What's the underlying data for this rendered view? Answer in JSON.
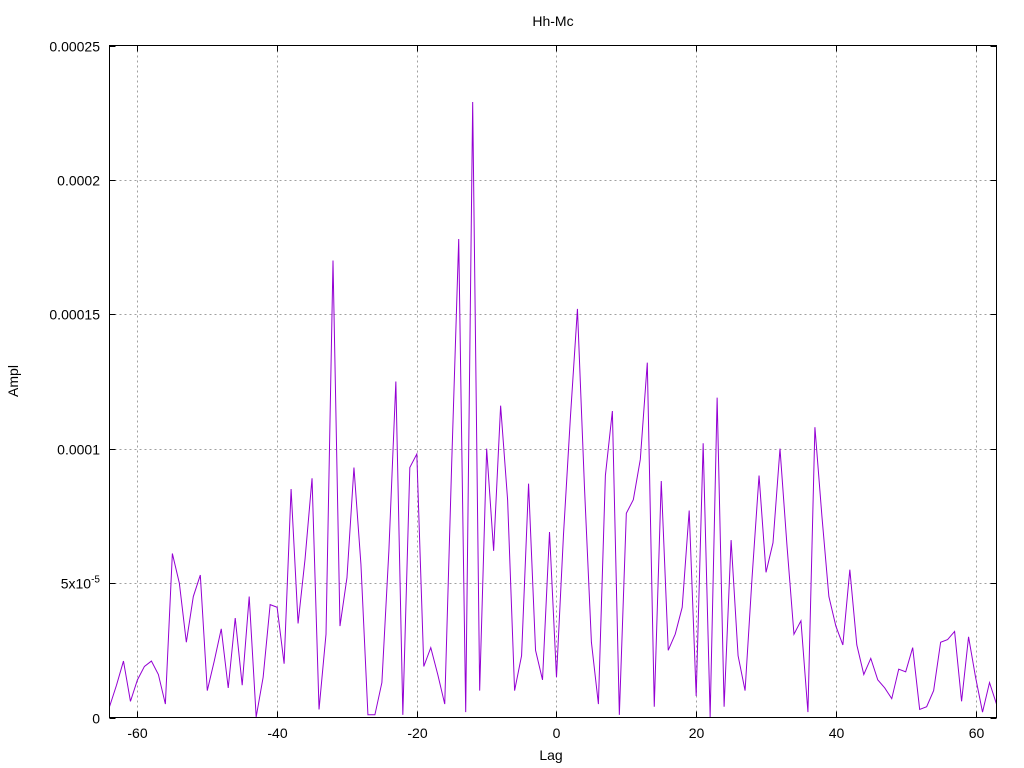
{
  "chart_data": {
    "type": "line",
    "title": "Hh-Mc",
    "xlabel": "Lag",
    "ylabel": "Ampl",
    "xlim": [
      -64,
      63
    ],
    "ylim": [
      0,
      0.00025
    ],
    "grid": true,
    "line_color": "#9400d3",
    "x_ticks": [
      {
        "value": -60,
        "label": "-60"
      },
      {
        "value": -40,
        "label": "-40"
      },
      {
        "value": -20,
        "label": "-20"
      },
      {
        "value": 0,
        "label": "0"
      },
      {
        "value": 20,
        "label": "20"
      },
      {
        "value": 40,
        "label": "40"
      },
      {
        "value": 60,
        "label": "60"
      }
    ],
    "y_ticks": [
      {
        "value": 0,
        "label": "0"
      },
      {
        "value": 5e-05,
        "label": "5x10",
        "sup": "-5"
      },
      {
        "value": 0.0001,
        "label": "0.0001"
      },
      {
        "value": 0.00015,
        "label": "0.00015"
      },
      {
        "value": 0.0002,
        "label": "0.0002"
      },
      {
        "value": 0.00025,
        "label": "0.00025"
      }
    ],
    "series": [
      {
        "x": [
          -64,
          -63,
          -62,
          -61,
          -60,
          -59,
          -58,
          -57,
          -56,
          -55,
          -54,
          -53,
          -52,
          -51,
          -50,
          -49,
          -48,
          -47,
          -46,
          -45,
          -44,
          -43,
          -42,
          -41,
          -40,
          -39,
          -38,
          -37,
          -36,
          -35,
          -34,
          -33,
          -32,
          -31,
          -30,
          -29,
          -28,
          -27,
          -26,
          -25,
          -24,
          -23,
          -22,
          -21,
          -20,
          -19,
          -18,
          -17,
          -16,
          -15,
          -14,
          -13,
          -12,
          -11,
          -10,
          -9,
          -8,
          -7,
          -6,
          -5,
          -4,
          -3,
          -2,
          -1,
          0,
          1,
          2,
          3,
          4,
          5,
          6,
          7,
          8,
          9,
          10,
          11,
          12,
          13,
          14,
          15,
          16,
          17,
          18,
          19,
          20,
          21,
          22,
          23,
          24,
          25,
          26,
          27,
          28,
          29,
          30,
          31,
          32,
          33,
          34,
          35,
          36,
          37,
          38,
          39,
          40,
          41,
          42,
          43,
          44,
          45,
          46,
          47,
          48,
          49,
          50,
          51,
          52,
          53,
          54,
          55,
          56,
          57,
          58,
          59,
          60,
          61,
          62,
          63
        ],
        "y": [
          4e-06,
          1.2e-05,
          2.1e-05,
          6e-06,
          1.4e-05,
          1.9e-05,
          2.1e-05,
          1.6e-05,
          5e-06,
          6.1e-05,
          5e-05,
          2.8e-05,
          4.5e-05,
          5.3e-05,
          1e-05,
          2.1e-05,
          3.3e-05,
          1.1e-05,
          3.7e-05,
          1.2e-05,
          4.5e-05,
          2e-07,
          1.5e-05,
          4.2e-05,
          4.1e-05,
          2e-05,
          8.5e-05,
          3.5e-05,
          5.9e-05,
          8.9e-05,
          3e-06,
          3.1e-05,
          0.00017,
          3.4e-05,
          5.2e-05,
          9.3e-05,
          5.7e-05,
          1e-06,
          1e-06,
          1.3e-05,
          6.2e-05,
          0.000125,
          1e-06,
          9.3e-05,
          9.8e-05,
          1.9e-05,
          2.6e-05,
          1.6e-05,
          5e-06,
          9.5e-05,
          0.000178,
          2e-06,
          0.000229,
          1e-05,
          0.0001,
          6.2e-05,
          0.000116,
          8.1e-05,
          1e-05,
          2.3e-05,
          8.7e-05,
          2.5e-05,
          1.4e-05,
          6.9e-05,
          1.5e-05,
          6.8e-05,
          0.000112,
          0.000152,
          8.6e-05,
          2.8e-05,
          5e-06,
          9e-05,
          0.000114,
          1e-06,
          7.6e-05,
          8.1e-05,
          9.6e-05,
          0.000132,
          4e-06,
          8.8e-05,
          2.5e-05,
          3.1e-05,
          4.1e-05,
          7.7e-05,
          8e-06,
          0.000102,
          2e-07,
          0.000119,
          4e-06,
          6.6e-05,
          2.3e-05,
          1e-05,
          5.2e-05,
          9e-05,
          5.4e-05,
          6.5e-05,
          0.0001,
          6.4e-05,
          3.1e-05,
          3.6e-05,
          2e-06,
          0.000108,
          7.5e-05,
          4.5e-05,
          3.4e-05,
          2.7e-05,
          5.5e-05,
          2.7e-05,
          1.6e-05,
          2.2e-05,
          1.4e-05,
          1.1e-05,
          7e-06,
          1.8e-05,
          1.7e-05,
          2.6e-05,
          3e-06,
          4e-06,
          1e-05,
          2.8e-05,
          2.9e-05,
          3.2e-05,
          6e-06,
          3e-05,
          1.5e-05,
          2e-06,
          1.3e-05,
          5e-06
        ]
      }
    ]
  }
}
